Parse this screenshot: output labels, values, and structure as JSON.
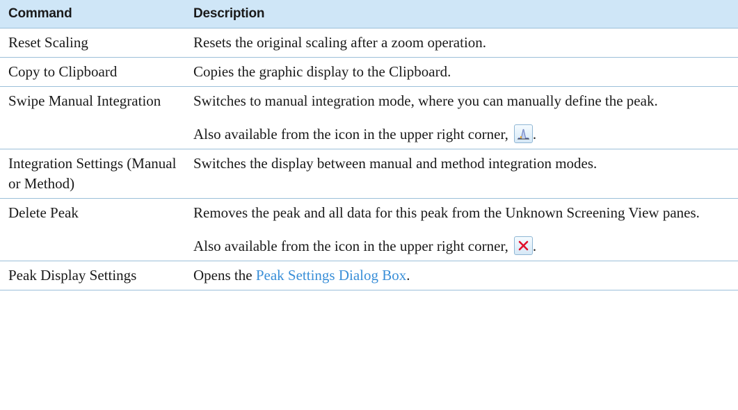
{
  "header": {
    "command": "Command",
    "description": "Description"
  },
  "rows": [
    {
      "command": "Reset Scaling",
      "description": "Resets the original scaling after a zoom operation."
    },
    {
      "command": "Copy to Clipboard",
      "description": "Copies the graphic display to the Clipboard."
    },
    {
      "command": "Swipe Manual Integration",
      "description": "Switches to manual integration mode, where you can manually define the peak.",
      "extra": "Also available from the icon in the upper right corner,",
      "extra_end": ".",
      "icon": "manual-integration-icon"
    },
    {
      "command": "Integration Settings (Manual or Method)",
      "description": "Switches the display between manual and method integration modes."
    },
    {
      "command": "Delete Peak",
      "description": "Removes the peak and all data for this peak from the Unknown Screening View panes.",
      "extra": "Also available from the icon in the upper right corner,",
      "extra_end": ".",
      "icon": "delete-x-icon"
    },
    {
      "command": "Peak Display Settings",
      "description_prefix": "Opens the",
      "link": "Peak Settings Dialog Box",
      "description_suffix": "."
    }
  ],
  "colors": {
    "header_bg": "#cfe6f7",
    "border": "#9bbfd9",
    "link": "#3a8fd8",
    "delete_icon": "#e0102a"
  }
}
